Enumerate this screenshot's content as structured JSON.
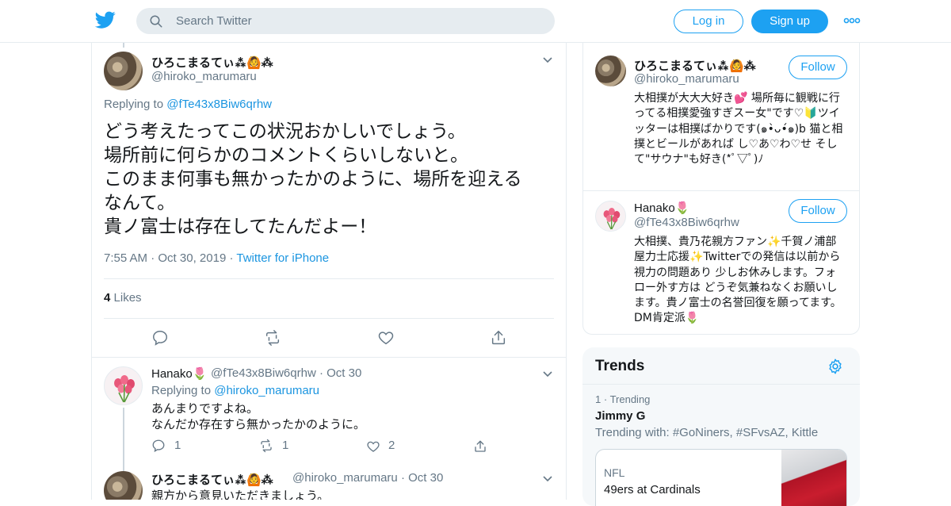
{
  "header": {
    "search_placeholder": "Search Twitter",
    "login_label": "Log in",
    "signup_label": "Sign up"
  },
  "main_tweet": {
    "name": "ひろこまるてぃ⁂🙆⁂",
    "handle": "@hiroko_marumaru",
    "replying_prefix": "Replying to",
    "replying_to": "@fTe43x8Biw6qrhw",
    "text": "どう考えたってこの状況おかしいでしょう。\n場所前に何らかのコメントくらいしないと。\nこのまま何事も無かったかのように、場所を迎える\nなんて。\n貴ノ富士は存在してたんだよー！",
    "time": "7:55 AM",
    "date": "Oct 30, 2019",
    "source": "Twitter for iPhone",
    "likes_count": "4",
    "likes_label": "Likes"
  },
  "replies": [
    {
      "name": "Hanako🌷",
      "handle": "@fTe43x8Biw6qrhw",
      "date": "Oct 30",
      "replying_prefix": "Replying to",
      "replying_to": "@hiroko_marumaru",
      "text": "あんまりですよね。\nなんだか存在すら無かったかのように。",
      "reply_count": "1",
      "retweet_count": "1",
      "like_count": "2"
    },
    {
      "name": "ひろこまるてぃ⁂🙆⁂",
      "handle": "@hiroko_marumaru",
      "date": "Oct 30",
      "text": "親方から意見いただきましょう。"
    }
  ],
  "sidebar_users": [
    {
      "name": "ひろこまるてぃ⁂🙆⁂",
      "handle": "@hiroko_marumaru",
      "follow_label": "Follow",
      "bio": "大相撲が大大大好き💕 場所毎に観戦に行ってる相撲愛強すぎスー女\"です♡🔰ツイッターは相撲ばかりです(๑•̀ᴗ•́๑)b 猫と相撲とビールがあれば し♡あ♡わ♡せ そして\"サウナ\"も好き(*ﾟ▽ﾟ)ﾉ"
    },
    {
      "name": "Hanako🌷",
      "handle": "@fTe43x8Biw6qrhw",
      "follow_label": "Follow",
      "bio": "大相撲、貴乃花親方ファン✨千賀ノ浦部屋力士応援✨Twitterでの発信は以前から視力の問題あり 少しお休みします。フォロー外す方は どうぞ気兼ねなくお願いします。貴ノ富士の名誉回復を願ってます。DM肯定派🌷"
    }
  ],
  "trends": {
    "title": "Trends",
    "item": {
      "rank": "1",
      "label": "Trending",
      "name": "Jimmy G",
      "with": "Trending with: #GoNiners, #SFvsAZ, Kittle"
    },
    "news": {
      "category": "NFL",
      "title": "49ers at Cardinals"
    }
  },
  "colors": {
    "accent": "#1da1f2",
    "link": "#1b95e0",
    "muted": "#657786",
    "border": "#e6ecf0"
  }
}
